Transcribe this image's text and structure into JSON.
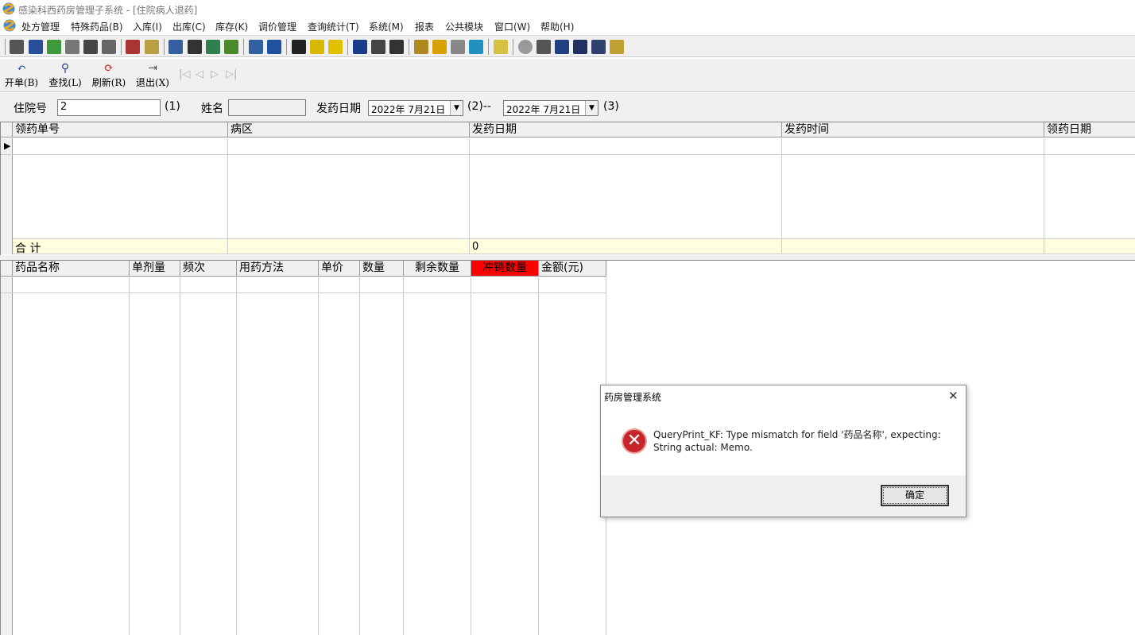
{
  "window": {
    "title": "感染科西药房管理子系统 - [住院病人退药]"
  },
  "menu": [
    "处方管理",
    "特殊药品(B)",
    "入库(I)",
    "出库(C)",
    "库存(K)",
    "调价管理",
    "查询统计(T)",
    "系统(M)",
    "报表",
    "公共模块",
    "窗口(W)",
    "帮助(H)"
  ],
  "actions": {
    "new": "开单(B)",
    "find": "查找(L)",
    "refresh": "刷新(R)",
    "exit": "退出(X)"
  },
  "filter": {
    "inpatient_no_label": "住院号",
    "inpatient_no_value": "2",
    "hint1": "(1)",
    "name_label": "姓名",
    "name_value": "",
    "dispense_date_label": "发药日期",
    "date_from": "2022年 7月21日",
    "hint2": "(2)--",
    "date_to": "2022年 7月21日",
    "hint3": "(3)"
  },
  "top_grid": {
    "columns": [
      "领药单号",
      "病区",
      "发药日期",
      "发药时间",
      "领药日期"
    ],
    "total_label": "合 计",
    "total_value": "0"
  },
  "bottom_grid": {
    "columns": [
      "药品名称",
      "单剂量",
      "频次",
      "用药方法",
      "单价",
      "数量",
      "剩余数量",
      "冲销数量",
      "金额(元)"
    ],
    "highlight_color": "#ff0000"
  },
  "dialog": {
    "title": "药房管理系统",
    "close": "✕",
    "message": "QueryPrint_KF: Type mismatch for field '药品名称', expecting: String actual: Memo.",
    "ok": "确定"
  }
}
